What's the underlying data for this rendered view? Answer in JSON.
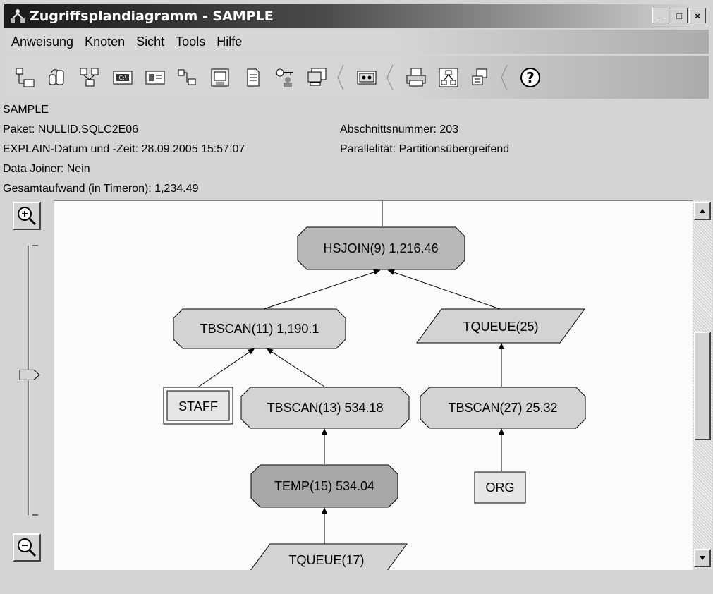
{
  "window": {
    "title": "Zugriffsplandiagramm - SAMPLE",
    "minimize_label": "_",
    "maximize_label": "□",
    "close_label": "×"
  },
  "menu": {
    "items": [
      {
        "first": "A",
        "rest": "nweisung"
      },
      {
        "first": "K",
        "rest": "noten"
      },
      {
        "first": "S",
        "rest": "icht"
      },
      {
        "first": "T",
        "rest": "ools"
      },
      {
        "first": "H",
        "rest": "ilfe"
      }
    ]
  },
  "toolbar": {
    "icons": [
      "tree-view-icon",
      "stats-icon",
      "graph-layout-icon",
      "command-icon",
      "node-details-icon",
      "table-icon",
      "document-icon",
      "key-user-icon",
      "monitor-icon",
      "view-icon",
      "print-icon",
      "diagram-icon",
      "overview-icon",
      "help-icon"
    ]
  },
  "info": {
    "database": "SAMPLE",
    "package": "Paket: NULLID.SQLC2E06",
    "section": "Abschnittsnummer: 203",
    "explain_datetime": "EXPLAIN-Datum und -Zeit: 28.09.2005 15:57:07",
    "parallelism": "Parallelität: Partitionsübergreifend",
    "data_joiner": "Data Joiner: Nein",
    "total_cost": "Gesamtaufwand (in Timeron): 1,234.49"
  },
  "graph": {
    "nodes": {
      "hsjoin": "HSJOIN(9) 1,216.46",
      "tbscan11": "TBSCAN(11) 1,190.1",
      "tqueue25": "TQUEUE(25)",
      "staff": "STAFF",
      "tbscan13": "TBSCAN(13) 534.18",
      "tbscan27": "TBSCAN(27) 25.32",
      "temp15": "TEMP(15) 534.04",
      "org": "ORG",
      "tqueue17": "TQUEUE(17)"
    }
  },
  "colors": {
    "node_fill": "#d3d3d3",
    "join_fill": "#b8b8b8",
    "temp_fill": "#a8a8a8",
    "canvas": "#fbfbfb"
  },
  "zoom": {
    "level": 0.52
  }
}
